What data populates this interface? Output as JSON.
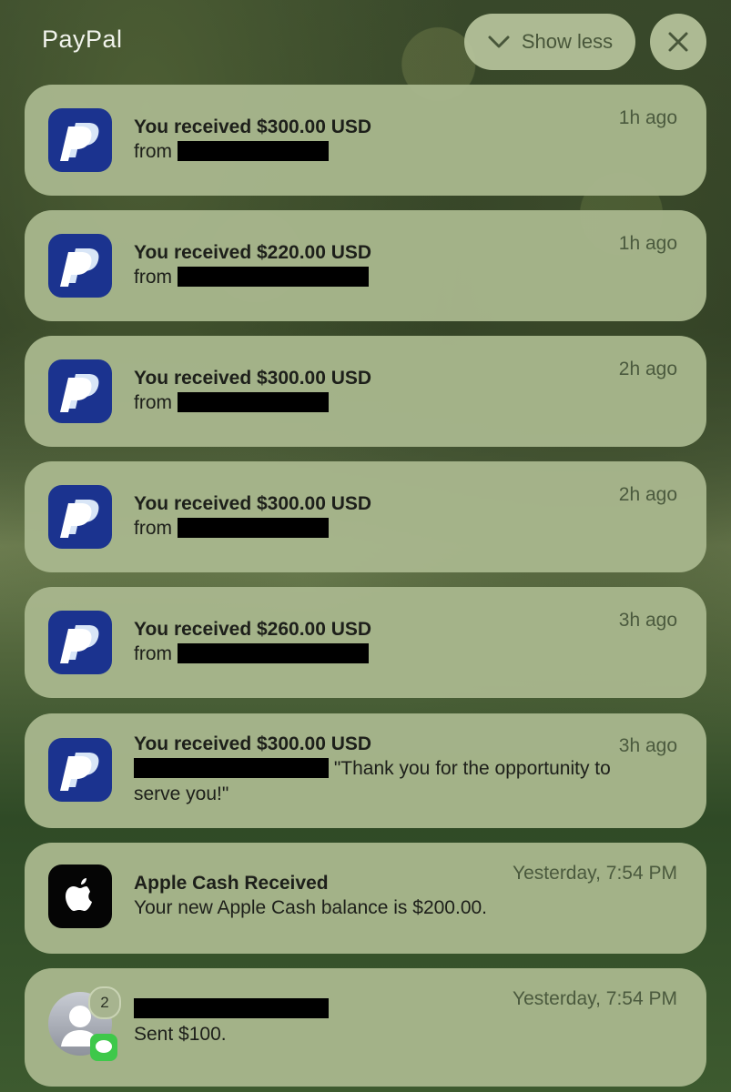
{
  "header": {
    "app_title": "PayPal",
    "show_less_label": "Show less"
  },
  "notifications": [
    {
      "title": "You received $300.00 USD",
      "body_prefix": "from",
      "time": "1h ago",
      "app": "paypal"
    },
    {
      "title": "You received $220.00 USD",
      "body_prefix": "from",
      "time": "1h ago",
      "app": "paypal"
    },
    {
      "title": "You received $300.00 USD",
      "body_prefix": "from",
      "time": "2h ago",
      "app": "paypal"
    },
    {
      "title": "You received $300.00 USD",
      "body_prefix": "from",
      "time": "2h ago",
      "app": "paypal"
    },
    {
      "title": "You received $260.00 USD",
      "body_prefix": "from",
      "time": "3h ago",
      "app": "paypal"
    },
    {
      "title": "You received $300.00 USD",
      "body_line1": "\"Thank you for the opportunity to",
      "body_line2": "serve you!\"",
      "time": "3h ago",
      "app": "paypal"
    },
    {
      "title": "Apple Cash Received",
      "body": "Your new Apple Cash balance is $200.00.",
      "time": "Yesterday, 7:54 PM",
      "app": "apple-cash"
    },
    {
      "body": "Sent $100.",
      "time": "Yesterday, 7:54 PM",
      "app": "messages",
      "badge_count": "2"
    }
  ],
  "colors": {
    "paypal_icon_bg": "#1b338f",
    "card_bg": "#a8b68d",
    "redaction": "#000000"
  }
}
